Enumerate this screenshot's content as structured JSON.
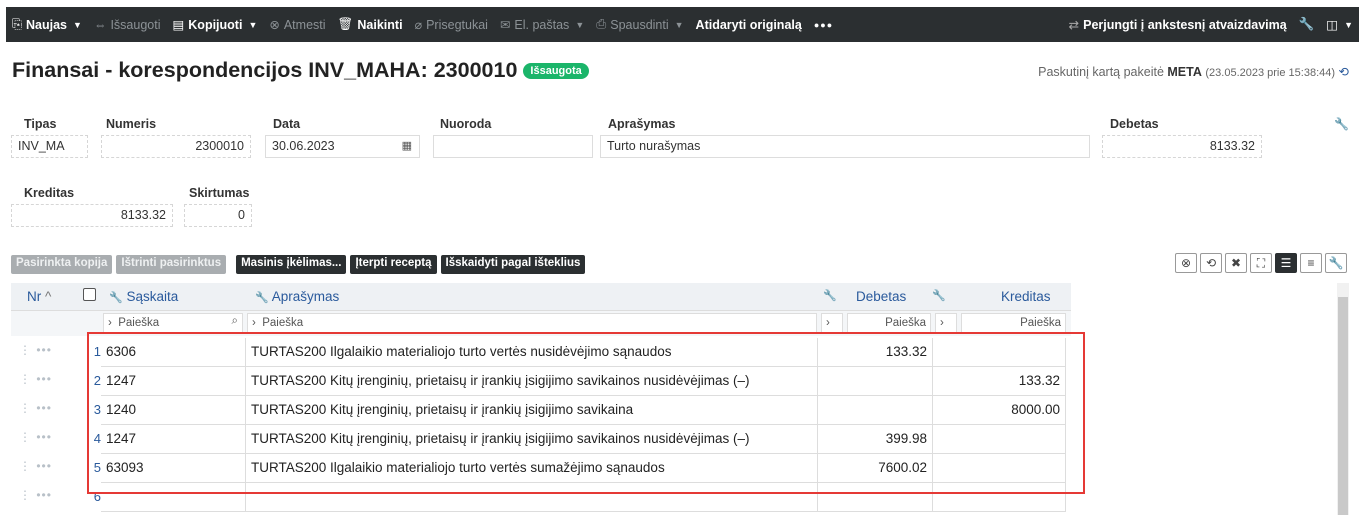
{
  "toolbar": {
    "new_label": "Naujas",
    "save_label": "Išsaugoti",
    "copy_label": "Kopijuoti",
    "cancel_label": "Atmesti",
    "delete_label": "Naikinti",
    "attach_label": "Prisegtukai",
    "email_label": "El. paštas",
    "print_label": "Spausdinti",
    "open_original_label": "Atidaryti originalą",
    "more_label": "●●●",
    "switch_view_label": "Perjungti į ankstesnį atvaizdavimą"
  },
  "page": {
    "title": "Finansai - korespondencijos INV_MAHA: 2300010",
    "status_badge": "Išsaugota",
    "last_changed_prefix": "Paskutinį kartą pakeitė",
    "last_changed_user": "META",
    "last_changed_time": "(23.05.2023 prie 15:38:44)"
  },
  "form": {
    "tipas_label": "Tipas",
    "tipas_value": "INV_MA",
    "numeris_label": "Numeris",
    "numeris_value": "2300010",
    "data_label": "Data",
    "data_value": "30.06.2023",
    "nuoroda_label": "Nuoroda",
    "nuoroda_value": "",
    "aprasymas_label": "Aprašymas",
    "aprasymas_value": "Turto nurašymas",
    "debetas_label": "Debetas",
    "debetas_value": "8133.32",
    "kreditas_label": "Kreditas",
    "kreditas_value": "8133.32",
    "skirtumas_label": "Skirtumas",
    "skirtumas_value": "0"
  },
  "actions": {
    "selected_copy": "Pasirinkta kopija",
    "delete_selected": "Ištrinti pasirinktus",
    "bulk_import": "Masinis įkėlimas...",
    "insert_recipe": "Įterpti receptą",
    "split_by_resources": "Išskaidyti pagal išteklius"
  },
  "grid": {
    "headers": {
      "nr": "Nr",
      "saskaita": "Sąskaita",
      "aprasymas": "Aprašymas",
      "debetas": "Debetas",
      "kreditas": "Kreditas"
    },
    "search_placeholder": "Paieška",
    "rows": [
      {
        "nr": "1",
        "saskaita": "6306",
        "aprasymas": "TURTAS200 Ilgalaikio materialiojo turto vertės nusidėvėjimo sąnaudos",
        "debetas": "133.32",
        "kreditas": ""
      },
      {
        "nr": "2",
        "saskaita": "1247",
        "aprasymas": "TURTAS200 Kitų įrenginių, prietaisų ir įrankių įsigijimo savikainos nusidėvėjimas (–)",
        "debetas": "",
        "kreditas": "133.32"
      },
      {
        "nr": "3",
        "saskaita": "1240",
        "aprasymas": "TURTAS200 Kitų įrenginių, prietaisų ir įrankių įsigijimo savikaina",
        "debetas": "",
        "kreditas": "8000.00"
      },
      {
        "nr": "4",
        "saskaita": "1247",
        "aprasymas": "TURTAS200 Kitų įrenginių, prietaisų ir įrankių įsigijimo savikainos nusidėvėjimas (–)",
        "debetas": "399.98",
        "kreditas": ""
      },
      {
        "nr": "5",
        "saskaita": "63093",
        "aprasymas": "TURTAS200 Ilgalaikio materialiojo turto vertės sumažėjimo sąnaudos",
        "debetas": "7600.02",
        "kreditas": ""
      },
      {
        "nr": "6",
        "saskaita": "",
        "aprasymas": "",
        "debetas": "",
        "kreditas": ""
      }
    ]
  },
  "colors": {
    "toolbar_bg": "#2b2f31",
    "badge_green": "#1bb56a",
    "link_blue": "#2a5a9c",
    "highlight_red": "#e53935"
  }
}
